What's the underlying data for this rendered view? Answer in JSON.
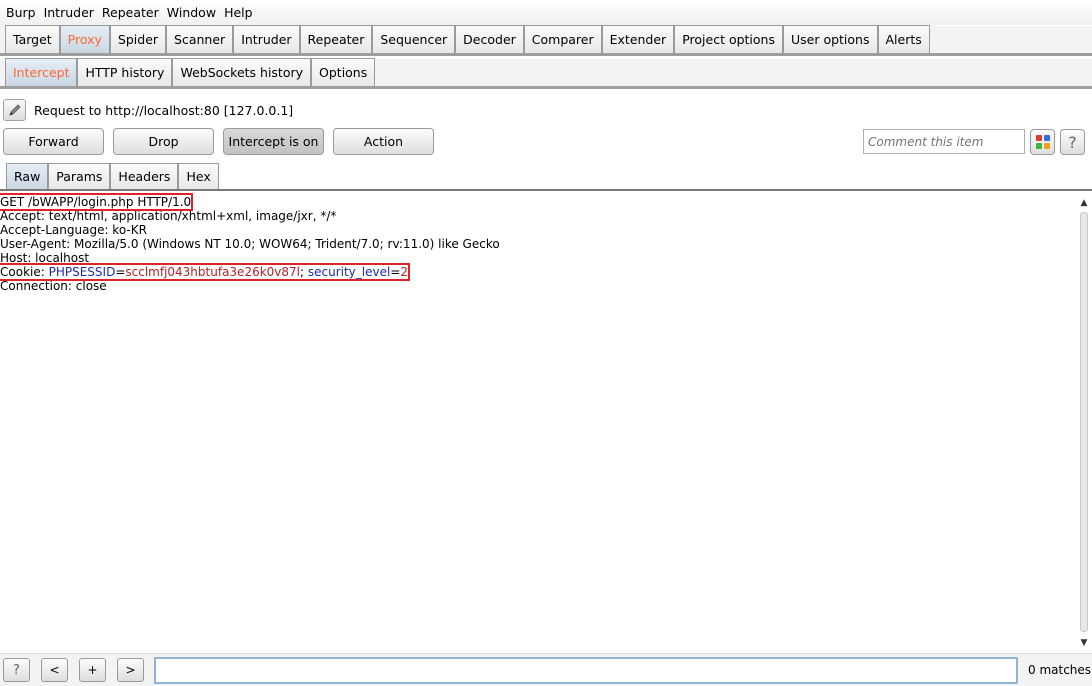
{
  "menubar": [
    "Burp",
    "Intruder",
    "Repeater",
    "Window",
    "Help"
  ],
  "main_tabs": [
    "Target",
    "Proxy",
    "Spider",
    "Scanner",
    "Intruder",
    "Repeater",
    "Sequencer",
    "Decoder",
    "Comparer",
    "Extender",
    "Project options",
    "User options",
    "Alerts"
  ],
  "main_active": "Proxy",
  "sub_tabs": [
    "Intercept",
    "HTTP history",
    "WebSockets history",
    "Options"
  ],
  "sub_active": "Intercept",
  "request_info": "Request to http://localhost:80  [127.0.0.1]",
  "buttons": {
    "forward": "Forward",
    "drop": "Drop",
    "intercept": "Intercept is on",
    "action": "Action"
  },
  "comment_placeholder": "Comment this item",
  "help_icon": "?",
  "view_tabs": [
    "Raw",
    "Params",
    "Headers",
    "Hex"
  ],
  "view_active": "Raw",
  "request": {
    "request_line": "GET /bWAPP/login.php HTTP/1.0",
    "accept": "Accept: text/html, application/xhtml+xml, image/jxr, */*",
    "accept_language": "Accept-Language: ko-KR",
    "user_agent": "User-Agent: Mozilla/5.0 (Windows NT 10.0; WOW64; Trident/7.0; rv:11.0) like Gecko",
    "host": "Host: localhost",
    "cookie_label": "Cookie: ",
    "cookie_name1": "PHPSESSID",
    "cookie_eq1": "=",
    "cookie_val1": "scclmfj043hbtufa3e26k0v87l",
    "cookie_sep": "; ",
    "cookie_name2": "security_level",
    "cookie_eq2": "=",
    "cookie_val2": "2",
    "connection": "Connection: close"
  },
  "search": {
    "help": "?",
    "prev": "<",
    "add": "+",
    "next": ">",
    "value": "",
    "matches": "0 matches"
  },
  "colors": {
    "accent_active_tab": "#ff6633",
    "highlight_box": "#e0222a",
    "cookie_name": "#1d2bb0",
    "cookie_value": "#b2222c"
  }
}
